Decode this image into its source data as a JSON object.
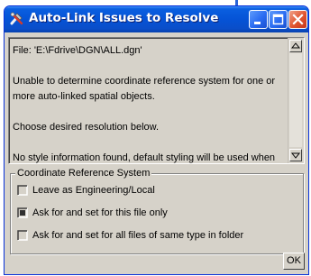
{
  "window": {
    "title": "Auto-Link Issues to Resolve",
    "title_icon": "tools-icon"
  },
  "message": {
    "lines": [
      "File: 'E:\\Fdrive\\DGN\\ALL.dgn'",
      "",
      "Unable to determine coordinate reference system for one or",
      "more auto-linked spatial objects.",
      "",
      "Choose desired resolution below.",
      "",
      "No style information found, default styling will be used when"
    ]
  },
  "crs_group": {
    "title": "Coordinate Reference System",
    "options": [
      {
        "label": "Leave as Engineering/Local",
        "selected": false
      },
      {
        "label": "Ask for and set for this file only",
        "selected": true
      },
      {
        "label": "Ask for and set for all files of same type in folder",
        "selected": false
      }
    ]
  },
  "buttons": {
    "ok": "OK"
  },
  "colors": {
    "titlebar": "#0553d6",
    "window_bg": "#d6d2c9",
    "close_button": "#e0542f"
  }
}
